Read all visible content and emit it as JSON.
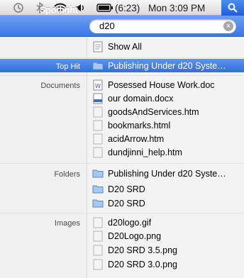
{
  "menubar": {
    "icons": [
      "time-machine-icon",
      "bluetooth-icon",
      "wifi-icon",
      "volume-icon",
      "battery-icon"
    ],
    "battery": "(6:23)",
    "clock": "Mon 3:09 PM"
  },
  "spotlight": {
    "label": "Spotlight",
    "query": "d20"
  },
  "show_all": "Show All",
  "categories": {
    "top_hit": "Top Hit",
    "documents": "Documents",
    "folders": "Folders",
    "images": "Images"
  },
  "top_hit": "Publishing Under d20 Syste…",
  "documents": [
    "Posessed House Work.doc",
    "our domain.docx",
    "goodsAndServices.htm",
    "bookmarks.html",
    "acidArrow.htm",
    "dundjinni_help.htm"
  ],
  "folders": [
    "Publishing Under d20 Syste…",
    "D20 SRD",
    "D20 SRD"
  ],
  "images": [
    "d20logo.gif",
    "D20Logo.png",
    "D20 SRD 3.5.png",
    "D20 SRD 3.0.png"
  ],
  "colors": {
    "accent": "#3a78e8",
    "highlight": "#3370dd"
  }
}
